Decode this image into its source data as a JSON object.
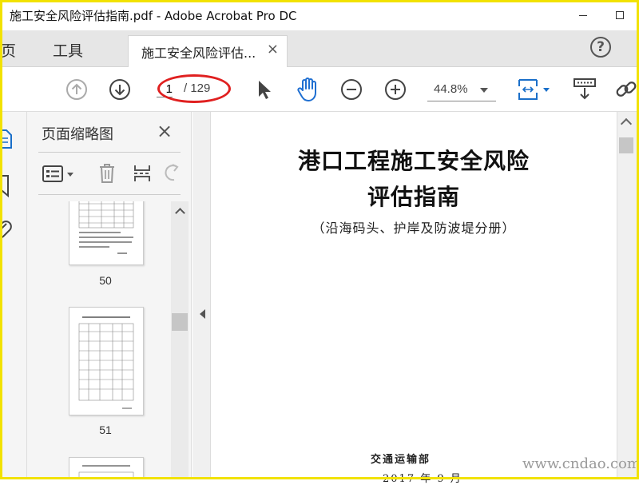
{
  "window": {
    "title": "施工安全风险评估指南.pdf - Adobe Acrobat Pro DC"
  },
  "tabs": {
    "home": "主页",
    "tools": "工具",
    "document": "施工安全风险评估...",
    "close": "×"
  },
  "toolbar": {
    "page_current": "1",
    "page_total": "/ 129",
    "zoom": "44.8%"
  },
  "panel": {
    "title": "页面缩略图",
    "close": "×",
    "thumbnails": [
      {
        "label": "50"
      },
      {
        "label": "51"
      }
    ]
  },
  "document": {
    "title_line1": "港口工程施工安全风险",
    "title_line2": "评估指南",
    "subtitle": "（沿海码头、护岸及防波堤分册）",
    "org": "交通运输部",
    "date": "2017 年 9 月"
  },
  "watermark": "www.cndao.com",
  "colors": {
    "highlight_ellipse": "#e02020",
    "frame": "#f2e200",
    "hand_tool": "#1f6fd1",
    "accent_icon": "#1a6fc9"
  },
  "icons": [
    "page-up-icon",
    "page-down-icon",
    "select-arrow-icon",
    "hand-tool-icon",
    "zoom-out-icon",
    "zoom-in-icon",
    "fit-page-icon",
    "scroll-mode-icon",
    "link-icon",
    "thumbnail-options-icon",
    "delete-page-icon",
    "insert-page-icon",
    "rotate-page-icon",
    "page-thumbnails-icon",
    "bookmark-icon",
    "attachment-icon",
    "help-icon"
  ]
}
